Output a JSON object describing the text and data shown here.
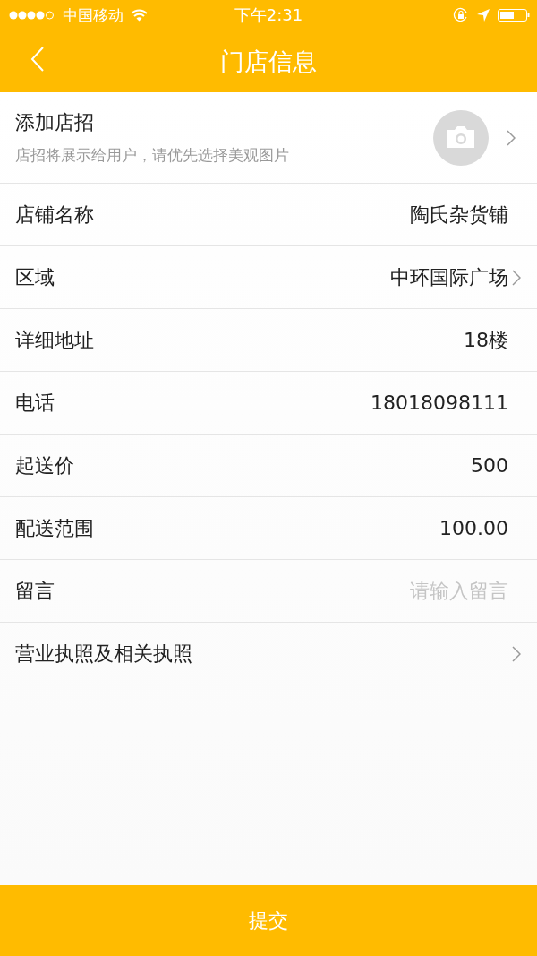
{
  "status_bar": {
    "carrier": "中国移动",
    "time": "下午2:31"
  },
  "nav": {
    "title": "门店信息"
  },
  "signboard": {
    "title": "添加店招",
    "hint": "店招将展示给用户，请优先选择美观图片"
  },
  "rows": [
    {
      "kind": "value",
      "label": "店铺名称",
      "value": "陶氏杂货铺"
    },
    {
      "kind": "select",
      "label": "区域",
      "value": "中环国际广场"
    },
    {
      "kind": "value",
      "label": "详细地址",
      "value": "18楼"
    },
    {
      "kind": "value",
      "label": "电话",
      "value": "18018098111"
    },
    {
      "kind": "value",
      "label": "起送价",
      "value": "500"
    },
    {
      "kind": "value",
      "label": "配送范围",
      "value": "100.00"
    },
    {
      "kind": "input",
      "label": "留言",
      "placeholder": "请输入留言"
    },
    {
      "kind": "link",
      "label": "营业执照及相关执照"
    }
  ],
  "submit": {
    "label": "提交"
  }
}
